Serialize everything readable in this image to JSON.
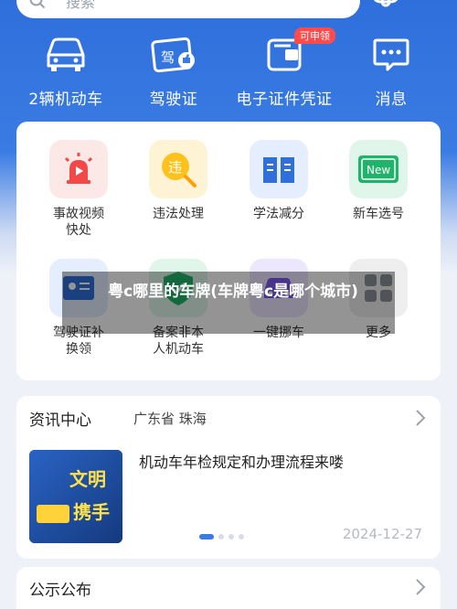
{
  "search": {
    "placeholder": "搜索"
  },
  "quick_menu": [
    {
      "label": "2辆机动车",
      "icon": "car-icon"
    },
    {
      "label": "驾驶证",
      "icon": "license-icon"
    },
    {
      "label": "电子证件凭证",
      "icon": "wallet-icon",
      "badge": "可申领"
    },
    {
      "label": "消息",
      "icon": "message-icon"
    }
  ],
  "services": [
    {
      "label1": "事故视频",
      "label2": "快处",
      "icon": "siren-icon",
      "color": "#fde8e8"
    },
    {
      "label1": "违法处理",
      "label2": "",
      "icon": "violation-icon",
      "color": "#fff3d6"
    },
    {
      "label1": "学法减分",
      "label2": "",
      "icon": "book-icon",
      "color": "#e4eeff"
    },
    {
      "label1": "新车选号",
      "label2": "",
      "icon": "new-plate-icon",
      "color": "#e1f6ea",
      "badge": "New"
    },
    {
      "label1": "驾驶证补",
      "label2": "换领",
      "icon": "license-renew-icon",
      "color": "#e4eeff"
    },
    {
      "label1": "备案非本",
      "label2": "人机动车",
      "icon": "shield-icon",
      "color": "#e1f6ea"
    },
    {
      "label1": "一键挪车",
      "label2": "",
      "icon": "move-car-icon",
      "color": "#ece6ff"
    },
    {
      "label1": "更多",
      "label2": "",
      "icon": "more-icon",
      "color": "#eeeeee"
    }
  ],
  "news": {
    "title": "资讯中心",
    "location": "广东省 珠海",
    "headline": "机动车年检规定和办理流程来喽",
    "date": "2024-12-27",
    "thumb_text1": "文明",
    "thumb_text2": "携手"
  },
  "notice": {
    "title": "公示公布"
  },
  "overlay": {
    "text": "粤c哪里的车牌(车牌粤c是哪个城市)"
  }
}
